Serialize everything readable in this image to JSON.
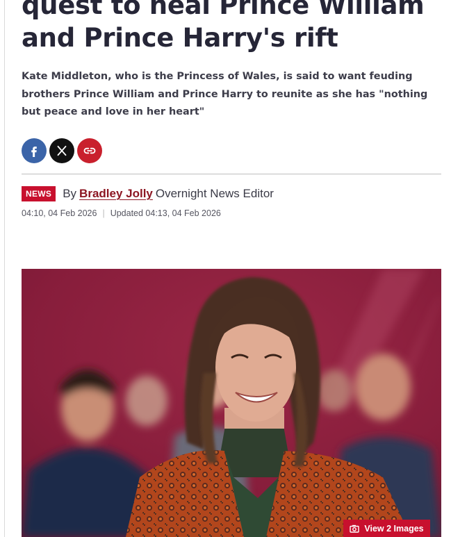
{
  "article": {
    "headline": "quest to heal Prince William and Prince Harry's rift",
    "standfirst": "Kate Middleton, who is the Princess of Wales, is said to want feuding brothers Prince William and Prince Harry to reunite as she has \"nothing but peace and love in her heart\"",
    "share": {
      "facebook_icon": "facebook-icon",
      "x_icon": "x-icon",
      "link_icon": "link-icon"
    },
    "byline": {
      "badge": "NEWS",
      "by": "By",
      "author": "Bradley Jolly",
      "role": "Overnight News Editor"
    },
    "dates": {
      "published": "04:10, 04 Feb 2026",
      "updated": "Updated 04:13, 04 Feb 2026"
    },
    "gallery": {
      "button_label": "View 2 Images",
      "icon": "camera-icon"
    }
  },
  "colors": {
    "brand_red": "#c8102e",
    "author_red": "#8c1622",
    "facebook_blue": "#3b64a8",
    "headline": "#262637"
  }
}
